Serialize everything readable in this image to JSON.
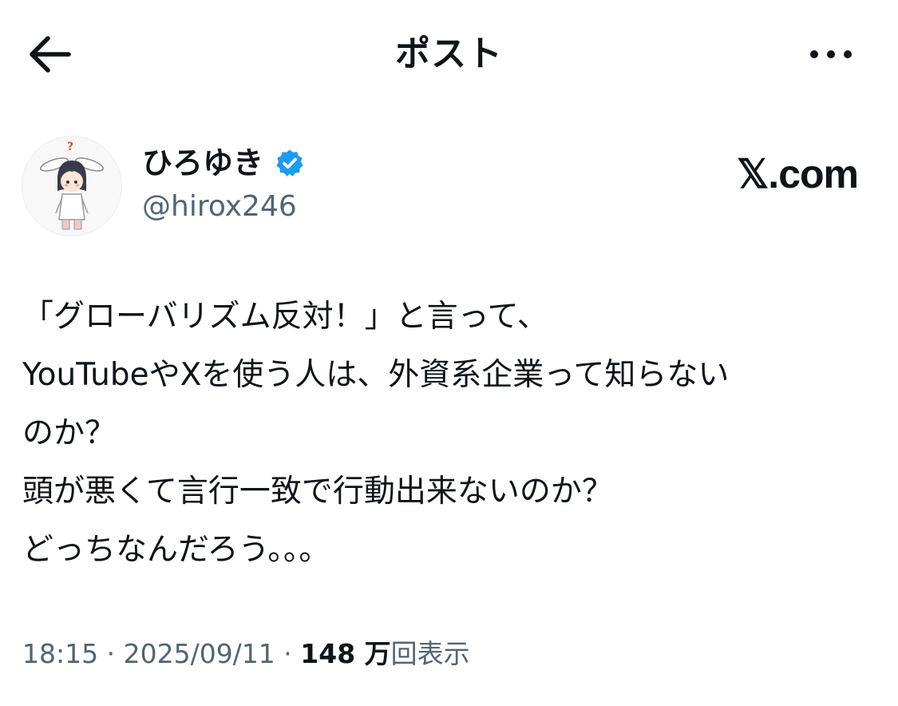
{
  "header": {
    "title": "ポスト",
    "back_icon": "arrow-left-icon",
    "more_icon": "more-dots-icon"
  },
  "author": {
    "display_name": "ひろゆき",
    "handle": "@hirox246",
    "verified": true,
    "verified_color": "#1d9bf0"
  },
  "brand": {
    "label": "𝕏.com"
  },
  "post": {
    "text": "「グローバリズム反対！」と言って、\nYouTubeやXを使う人は、外資系企業って知らない\nのか？\n頭が悪くて言行一致で行動出来ないのか？\nどっちなんだろう。。。"
  },
  "meta": {
    "time": "18:15",
    "separator": " · ",
    "date": "2025/09/11",
    "views_count": "148 万",
    "views_label": "回表示"
  },
  "colors": {
    "text": "#0f1419",
    "secondary": "#536471",
    "accent": "#1d9bf0"
  }
}
